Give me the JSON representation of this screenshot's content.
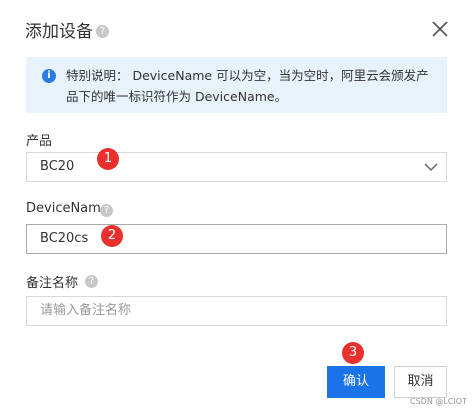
{
  "dialog": {
    "title": "添加设备",
    "help_glyph": "?",
    "close_glyph": "×"
  },
  "notice": {
    "icon_glyph": "i",
    "text": "特别说明： DeviceName 可以为空，当为空时，阿里云会颁发产品下的唯一标识符作为 DeviceName。"
  },
  "form": {
    "product": {
      "label": "产品",
      "value": "BC20"
    },
    "device_name": {
      "label": "DeviceName",
      "value": "BC20cs"
    },
    "nickname": {
      "label": "备注名称",
      "placeholder": "请输入备注名称"
    }
  },
  "annotations": [
    "1",
    "2",
    "3"
  ],
  "buttons": {
    "confirm": "确认",
    "cancel": "取消"
  },
  "watermark": "CSDN @LCIOT",
  "colors": {
    "primary": "#1a73e8",
    "info_bg": "#e8f2fb",
    "info_icon": "#2a7ee0",
    "badge": "#e8302c"
  }
}
